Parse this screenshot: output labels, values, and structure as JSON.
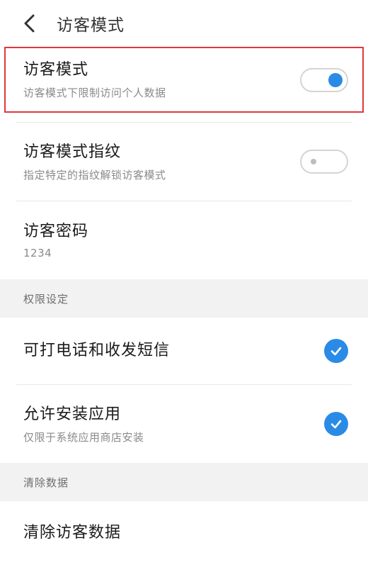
{
  "header": {
    "title": "访客模式"
  },
  "rows": {
    "guest_mode": {
      "title": "访客模式",
      "subtitle": "访客模式下限制访问个人数据",
      "enabled": true
    },
    "guest_fingerprint": {
      "title": "访客模式指纹",
      "subtitle": "指定特定的指纹解锁访客模式",
      "enabled": false
    },
    "guest_password": {
      "title": "访客密码",
      "value": "1234"
    }
  },
  "sections": {
    "permissions": {
      "label": "权限设定",
      "items": [
        {
          "title": "可打电话和收发短信",
          "subtitle": "",
          "checked": true
        },
        {
          "title": "允许安装应用",
          "subtitle": "仅限于系统应用商店安装",
          "checked": true
        }
      ]
    },
    "clear": {
      "label": "清除数据",
      "items": [
        {
          "title": "清除访客数据"
        }
      ]
    }
  },
  "colors": {
    "accent": "#2a8be6",
    "highlight_border": "#e0383e",
    "section_bg": "#f2f2f2"
  },
  "icons": {
    "back": "chevron-left-icon",
    "check": "checkmark-icon"
  }
}
